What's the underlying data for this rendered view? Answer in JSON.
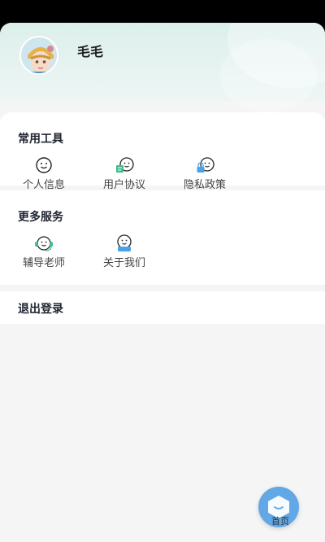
{
  "profile": {
    "name": "毛毛"
  },
  "common_tools": {
    "title": "常用工具",
    "items": [
      {
        "label": "个人信息",
        "icon": "smiley-face-icon"
      },
      {
        "label": "用户协议",
        "icon": "smiley-document-icon"
      },
      {
        "label": "隐私政策",
        "icon": "smiley-lock-icon"
      }
    ]
  },
  "more_services": {
    "title": "更多服务",
    "items": [
      {
        "label": "辅导老师",
        "icon": "smiley-headset-icon"
      },
      {
        "label": "关于我们",
        "icon": "smiley-badge-icon"
      }
    ]
  },
  "logout": {
    "label": "退出登录"
  },
  "bottom_nav": {
    "home_label": "首页"
  },
  "colors": {
    "accent": "#62a8e6",
    "header_bg": "#dcefeb",
    "icon_green": "#3cbf8a",
    "icon_blue": "#4aa3e8"
  }
}
